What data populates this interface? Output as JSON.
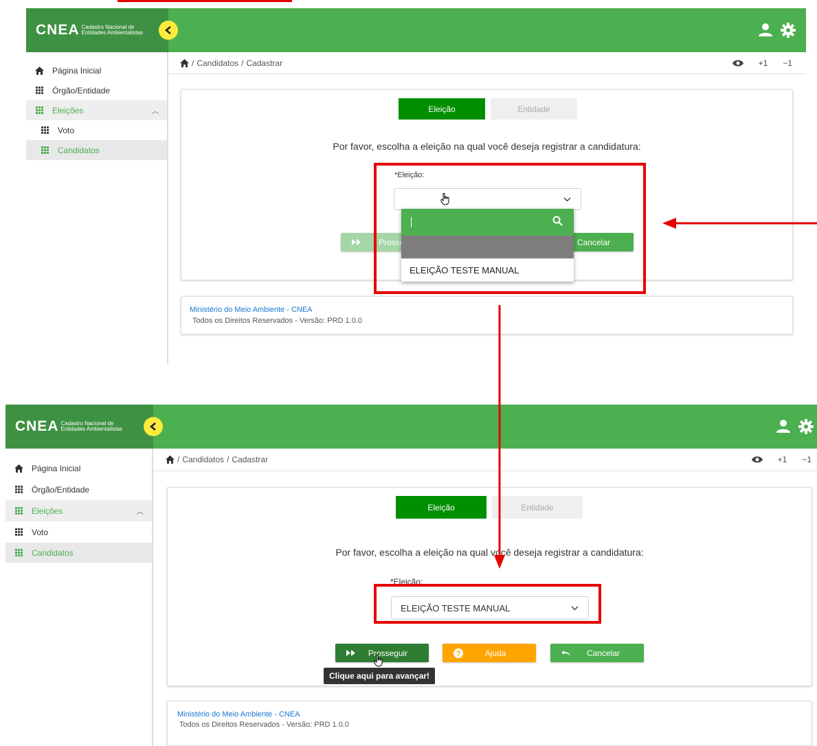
{
  "brand": {
    "short": "CNEA",
    "full_line1": "Cadastro Nacional de",
    "full_line2": "Entidades Ambientalistas"
  },
  "sidebar": {
    "items": [
      {
        "label": "Página Inicial",
        "icon": "home-icon"
      },
      {
        "label": "Órgão/Entidade",
        "icon": "grid-icon"
      },
      {
        "label": "Eleições",
        "icon": "grid-icon"
      },
      {
        "label": "Voto",
        "icon": "grid-icon"
      },
      {
        "label": "Candidatos",
        "icon": "grid-icon"
      }
    ]
  },
  "breadcrumb": {
    "sep": "/",
    "level1": "Candidatos",
    "level2": "Cadastrar",
    "font_increase": "+1",
    "font_decrease": "−1"
  },
  "tabs": {
    "election": "Eleição",
    "entity": "Entidade"
  },
  "form": {
    "prompt": "Por favor, escolha a eleição na qual você deseja registrar a candidatura:",
    "label": "*Eleição:",
    "selected_value": "ELEIÇÃO TESTE MANUAL",
    "option": "ELEIÇÃO TESTE MANUAL"
  },
  "buttons": {
    "proceed": "Prosseguir",
    "proceed_partial": "Prosseg",
    "help": "Ajuda",
    "cancel": "Cancelar"
  },
  "tooltip": {
    "text": "Clique aqui para avançar!"
  },
  "footer": {
    "line1": "Ministério do Meio Ambiente - CNEA",
    "line2": "Todos os Direitos Reservados - Versão: PRD 1.0.0"
  },
  "colors": {
    "topbar": "#4caf50",
    "brand_bg": "#3e9142",
    "tab_active": "#008f00",
    "proceed": "#2e7d32",
    "help": "#ffa500",
    "cancel": "#4caf50",
    "annotation": "#e60000"
  }
}
